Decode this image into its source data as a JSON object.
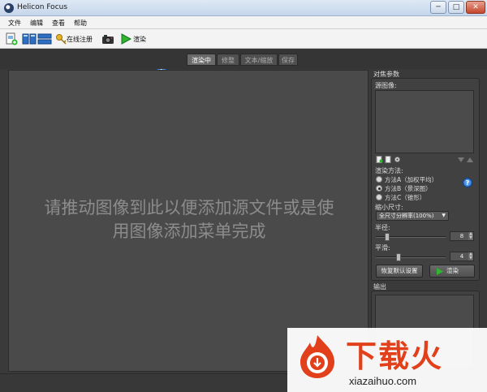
{
  "window": {
    "title": "Helicon Focus",
    "minimize": "─",
    "maximize": "□",
    "close": "✕"
  },
  "menu": {
    "items": [
      "文件",
      "编辑",
      "查看",
      "帮助"
    ]
  },
  "toolbar": {
    "register_label": "在线注册",
    "render_label": "渲染"
  },
  "tabs": [
    {
      "label": "渲染中",
      "active": true
    },
    {
      "label": "修整",
      "active": false
    },
    {
      "label": "文本/缩放",
      "active": false
    },
    {
      "label": "保存",
      "active": false
    }
  ],
  "canvas": {
    "drop_hint_line1": "请推动图像到此以便添加源文件或是使",
    "drop_hint_line2": "用图像添加菜单完成"
  },
  "panel": {
    "focus_params_label": "对焦参数",
    "source_images_label": "源图像:",
    "method_label": "渲染方法:",
    "methods": [
      {
        "label": "方法A（加权平均）",
        "selected": false
      },
      {
        "label": "方法B（景深图）",
        "selected": true
      },
      {
        "label": "方法C（锥形）",
        "selected": false
      }
    ],
    "reduce_size_label": "缩小尺寸:",
    "reduce_size_value": "全尺寸分辨率(100%)",
    "radius_label": "半径:",
    "radius_value": "8",
    "smoothing_label": "平滑:",
    "smoothing_value": "4",
    "reset_button": "恢复默认设置",
    "render_button": "渲染",
    "output_label": "输出",
    "help_glyph": "?"
  },
  "watermark": {
    "brand": "下载火",
    "url": "xiazaihuo.com"
  },
  "colors": {
    "accent_green": "#2fb52f",
    "help_blue": "#1d62c3",
    "brand_orange": "#e2401a"
  }
}
